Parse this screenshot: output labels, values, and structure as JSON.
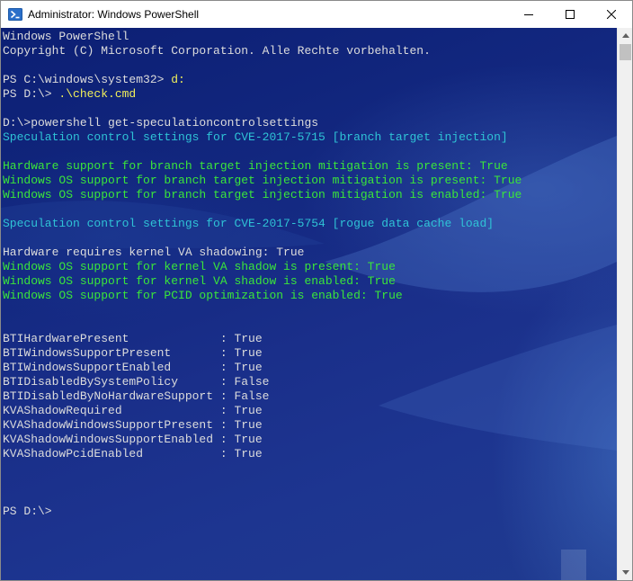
{
  "window": {
    "title": "Administrator: Windows PowerShell",
    "icon": "powershell-icon",
    "controls": [
      "minimize-icon",
      "maximize-icon",
      "close-icon"
    ]
  },
  "console": {
    "lines": [
      {
        "text": "Windows PowerShell",
        "color": "white"
      },
      {
        "text": "Copyright (C) Microsoft Corporation. Alle Rechte vorbehalten.",
        "color": "white"
      },
      {
        "text": "",
        "color": "white"
      },
      {
        "prompt": "PS C:\\windows\\system32> ",
        "cmd": "d:",
        "color": "white"
      },
      {
        "prompt": "PS D:\\> ",
        "cmd": ".\\check.cmd",
        "color": "white"
      },
      {
        "text": "",
        "color": "white"
      },
      {
        "text": "D:\\>powershell get-speculationcontrolsettings",
        "color": "white"
      },
      {
        "text": "Speculation control settings for CVE-2017-5715 [branch target injection]",
        "color": "cyan"
      },
      {
        "text": "",
        "color": "white"
      },
      {
        "text": "Hardware support for branch target injection mitigation is present: True",
        "color": "green"
      },
      {
        "text": "Windows OS support for branch target injection mitigation is present: True",
        "color": "green"
      },
      {
        "text": "Windows OS support for branch target injection mitigation is enabled: True",
        "color": "green"
      },
      {
        "text": "",
        "color": "white"
      },
      {
        "text": "Speculation control settings for CVE-2017-5754 [rogue data cache load]",
        "color": "cyan"
      },
      {
        "text": "",
        "color": "white"
      },
      {
        "text": "Hardware requires kernel VA shadowing: True",
        "color": "white"
      },
      {
        "text": "Windows OS support for kernel VA shadow is present: True",
        "color": "green"
      },
      {
        "text": "Windows OS support for kernel VA shadow is enabled: True",
        "color": "green"
      },
      {
        "text": "Windows OS support for PCID optimization is enabled: True",
        "color": "green"
      },
      {
        "text": "",
        "color": "white"
      },
      {
        "text": "",
        "color": "white"
      },
      {
        "text": "BTIHardwarePresent             : True",
        "color": "white"
      },
      {
        "text": "BTIWindowsSupportPresent       : True",
        "color": "white"
      },
      {
        "text": "BTIWindowsSupportEnabled       : True",
        "color": "white"
      },
      {
        "text": "BTIDisabledBySystemPolicy      : False",
        "color": "white"
      },
      {
        "text": "BTIDisabledByNoHardwareSupport : False",
        "color": "white"
      },
      {
        "text": "KVAShadowRequired              : True",
        "color": "white"
      },
      {
        "text": "KVAShadowWindowsSupportPresent : True",
        "color": "white"
      },
      {
        "text": "KVAShadowWindowsSupportEnabled : True",
        "color": "white"
      },
      {
        "text": "KVAShadowPcidEnabled           : True",
        "color": "white"
      },
      {
        "text": "",
        "color": "white"
      },
      {
        "text": "",
        "color": "white"
      },
      {
        "text": "",
        "color": "white"
      },
      {
        "text": "PS D:\\>",
        "color": "white"
      }
    ]
  },
  "colors": {
    "white": "#dcdcdc",
    "cyan": "#2fc3d6",
    "green": "#3ae63a",
    "yellow": "#f0ee5a",
    "background": "#12277f"
  },
  "scrollbar": {
    "up": "scroll-up-arrow-icon",
    "down": "scroll-down-arrow-icon"
  }
}
